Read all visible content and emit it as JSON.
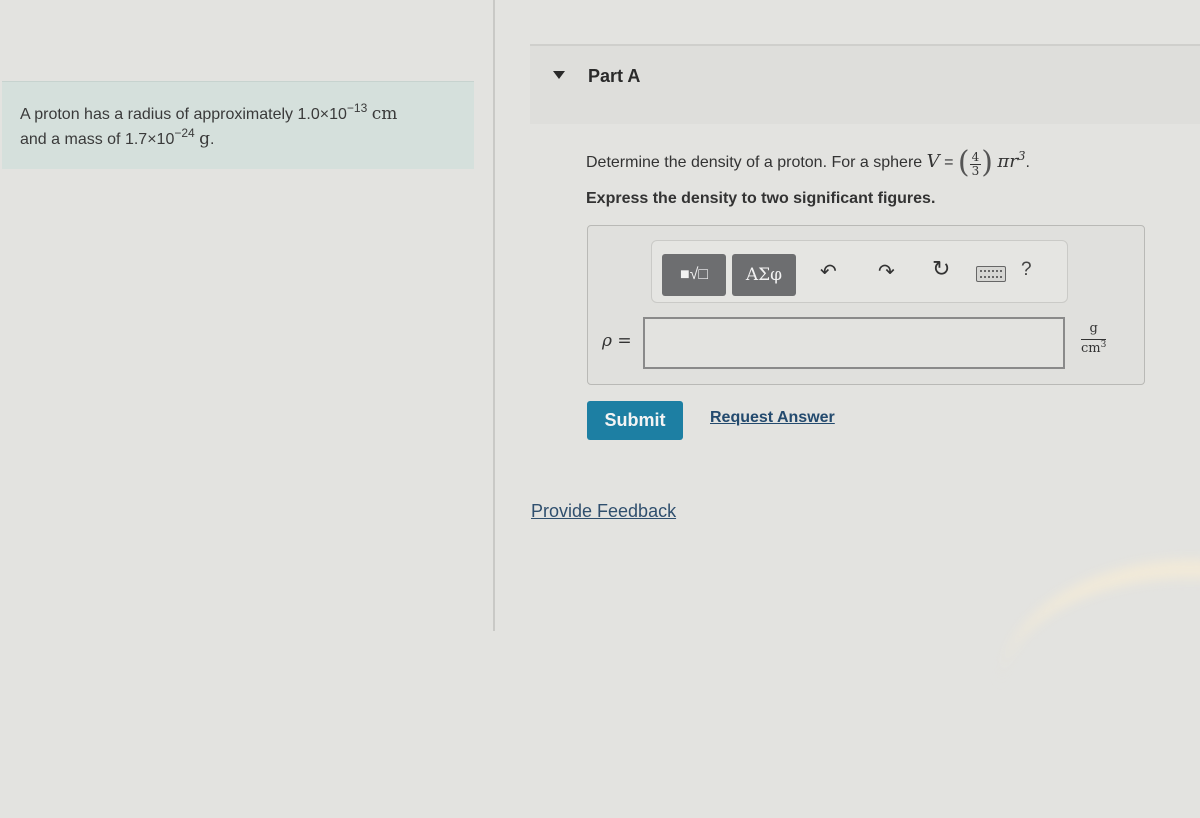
{
  "problem": {
    "line1_prefix": "A proton has a radius of approximately ",
    "radius_mantissa": "1.0×10",
    "radius_exponent": "−13",
    "radius_unit": "cm",
    "line2_prefix": "and a mass of ",
    "mass_mantissa": "1.7×10",
    "mass_exponent": "−24",
    "mass_unit": "g",
    "line2_suffix": "."
  },
  "part": {
    "title": "Part A",
    "caret_icon": "caret-down-icon",
    "question_prefix": "Determine the density of a proton. For a sphere ",
    "formula_lhs": "V",
    "formula_eq": " = ",
    "frac_num": "4",
    "frac_den": "3",
    "formula_rhs": "πr",
    "formula_rhs_exp": "3",
    "formula_end": ".",
    "instruction": "Express the density to two significant figures."
  },
  "toolbar": {
    "templates_icon": "■√□",
    "symbols_label": "ΑΣφ",
    "undo_icon": "↶",
    "redo_icon": "↷",
    "reset_icon": "↻",
    "keyboard_icon": "keyboard-icon",
    "help_label": "?"
  },
  "answer": {
    "variable_label": "ρ =",
    "input_value": "",
    "unit_num": "g",
    "unit_den": "cm",
    "unit_den_exp": "3"
  },
  "actions": {
    "submit_label": "Submit",
    "request_answer_label": "Request Answer",
    "feedback_label": "Provide Feedback"
  },
  "colors": {
    "submit_bg": "#1d7fa3",
    "problem_bg": "#d5e0dc",
    "page_bg": "#e3e3e0",
    "link": "#234a6e"
  }
}
